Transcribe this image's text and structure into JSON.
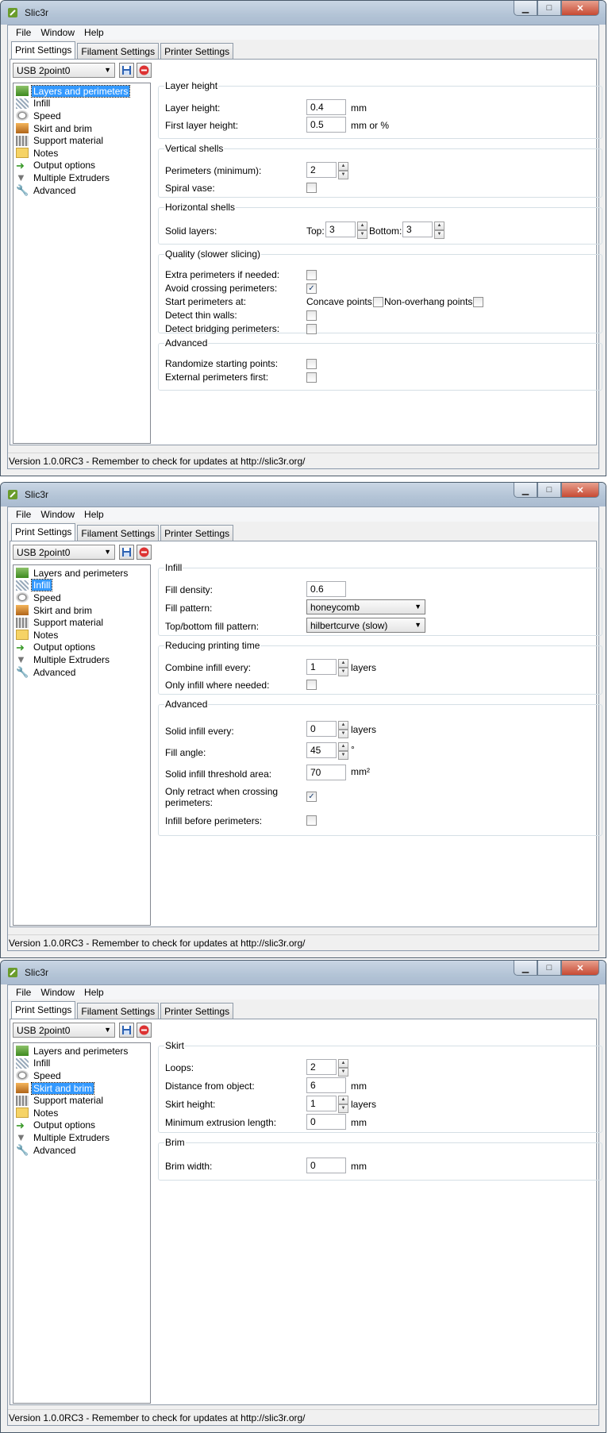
{
  "app_title": "Slic3r",
  "menu": [
    "File",
    "Window",
    "Help"
  ],
  "tabs": [
    "Print Settings",
    "Filament Settings",
    "Printer Settings"
  ],
  "preset": "USB 2point0",
  "tree": [
    "Layers and perimeters",
    "Infill",
    "Speed",
    "Skirt and brim",
    "Support material",
    "Notes",
    "Output options",
    "Multiple Extruders",
    "Advanced"
  ],
  "status": "Version 1.0.0RC3 - Remember to check for updates at http://slic3r.org/",
  "w1": {
    "layer_height": {
      "title": "Layer height",
      "lh_label": "Layer height:",
      "lh_value": "0.4",
      "lh_unit": "mm",
      "flh_label": "First layer height:",
      "flh_value": "0.5",
      "flh_unit": "mm or %"
    },
    "vertical": {
      "title": "Vertical shells",
      "per_label": "Perimeters (minimum):",
      "per_value": "2",
      "spiral_label": "Spiral vase:"
    },
    "horizontal": {
      "title": "Horizontal shells",
      "solid_label": "Solid layers:",
      "top_label": "Top:",
      "top_value": "3",
      "bottom_label": "Bottom:",
      "bottom_value": "3"
    },
    "quality": {
      "title": "Quality (slower slicing)",
      "extra": "Extra perimeters if needed:",
      "avoid": "Avoid crossing perimeters:",
      "start": "Start perimeters at:",
      "concave": "Concave points:",
      "nonoverhang": "Non-overhang points:",
      "thin": "Detect thin walls:",
      "bridging": "Detect bridging perimeters:"
    },
    "advanced": {
      "title": "Advanced",
      "randomize": "Randomize starting points:",
      "external": "External perimeters first:"
    }
  },
  "w2": {
    "infill": {
      "title": "Infill",
      "density_label": "Fill density:",
      "density_value": "0.6",
      "pattern_label": "Fill pattern:",
      "pattern_value": "honeycomb",
      "tb_label": "Top/bottom fill pattern:",
      "tb_value": "hilbertcurve (slow)"
    },
    "reducing": {
      "title": "Reducing printing time",
      "combine_label": "Combine infill every:",
      "combine_value": "1",
      "combine_unit": "layers",
      "only_label": "Only infill where needed:"
    },
    "advanced": {
      "title": "Advanced",
      "solid_label": "Solid infill every:",
      "solid_value": "0",
      "solid_unit": "layers",
      "angle_label": "Fill angle:",
      "angle_value": "45",
      "angle_unit": "°",
      "thresh_label": "Solid infill threshold area:",
      "thresh_value": "70",
      "thresh_unit": "mm²",
      "retract_label1": "Only retract when crossing",
      "retract_label2": "perimeters:",
      "before_label": "Infill before perimeters:"
    }
  },
  "w3": {
    "skirt": {
      "title": "Skirt",
      "loops_label": "Loops:",
      "loops_value": "2",
      "dist_label": "Distance from object:",
      "dist_value": "6",
      "dist_unit": "mm",
      "height_label": "Skirt height:",
      "height_value": "1",
      "height_unit": "layers",
      "minext_label": "Minimum extrusion length:",
      "minext_value": "0",
      "minext_unit": "mm"
    },
    "brim": {
      "title": "Brim",
      "width_label": "Brim width:",
      "width_value": "0",
      "width_unit": "mm"
    }
  }
}
